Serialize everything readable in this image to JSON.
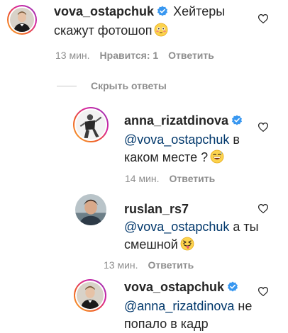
{
  "comments": [
    {
      "username": "vova_ostapchuk",
      "text_line1": "Хейтеры",
      "text_line2": "скажут фотошоп",
      "time": "13 мин.",
      "likes": "Нравится: 1",
      "reply": "Ответить"
    }
  ],
  "hide_replies": "Скрыть ответы",
  "replies": [
    {
      "username": "anna_rizatdinova",
      "mention": "@vova_ostapchuk",
      "text_after_mention": "в",
      "text_line3": "каком месте ?",
      "time": "14 мин.",
      "reply": "Ответить"
    },
    {
      "username": "ruslan_rs7",
      "mention": "@vova_ostapchuk",
      "text_after_mention": "а ты",
      "text_line3": "смешной",
      "time": "13 мин.",
      "reply": "Ответить"
    },
    {
      "username": "vova_ostapchuk",
      "mention": "@anna_rizatdinova",
      "text_after_mention": "не",
      "text_line3": "попало в кадр",
      "time": "",
      "reply": ""
    }
  ],
  "icons": {
    "verified": "verified-badge-icon",
    "like": "heart-outline-icon"
  },
  "colors": {
    "verified_blue": "#3897f0",
    "mention": "#00376b",
    "muted": "#8e8e8e"
  }
}
